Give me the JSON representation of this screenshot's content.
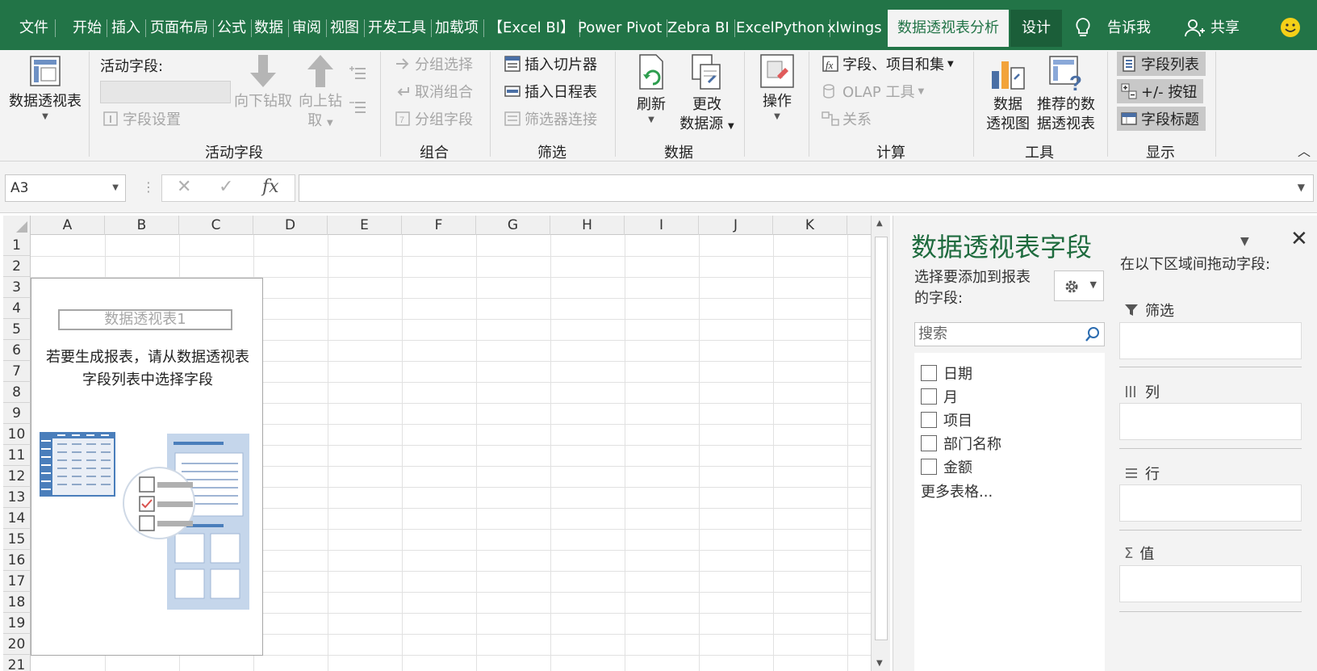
{
  "tabs": {
    "file": "文件",
    "home": "开始",
    "insert": "插入",
    "page_layout": "页面布局",
    "formulas": "公式",
    "data": "数据",
    "review": "审阅",
    "view": "视图",
    "developer": "开发工具",
    "addins": "加载项",
    "excel_bi": "【Excel BI】",
    "power_pivot": "Power Pivot",
    "zebra_bi": "Zebra BI",
    "excel_python": "ExcelPython",
    "xlwings": "xlwings",
    "pivot_analyze": "数据透视表分析",
    "design": "设计",
    "tell_me": "告诉我",
    "share": "共享"
  },
  "ribbon": {
    "pivottable": {
      "label": "数据透视表"
    },
    "active_field": {
      "label": "活动字段:",
      "field_settings": "字段设置",
      "drill_down": "向下钻取",
      "drill_up_1": "向上钻",
      "drill_up_2": "取",
      "group_label": "活动字段"
    },
    "group": {
      "group_selection": "分组选择",
      "ungroup": "取消组合",
      "group_field": "分组字段",
      "group_label": "组合"
    },
    "filter": {
      "insert_slicer": "插入切片器",
      "insert_timeline": "插入日程表",
      "filter_connections": "筛选器连接",
      "group_label": "筛选"
    },
    "data": {
      "refresh": "刷新",
      "change_source_1": "更改",
      "change_source_2": "数据源",
      "group_label": "数据"
    },
    "actions": {
      "label": "操作"
    },
    "calc": {
      "fields_items_sets": "字段、项目和集",
      "olap_tools": "OLAP 工具",
      "relationships": "关系",
      "group_label": "计算"
    },
    "tools": {
      "pivotchart_1": "数据",
      "pivotchart_2": "透视图",
      "recommended_1": "推荐的数",
      "recommended_2": "据透视表",
      "group_label": "工具"
    },
    "show": {
      "field_list": "字段列表",
      "buttons": "+/- 按钮",
      "field_headers": "字段标题",
      "group_label": "显示"
    }
  },
  "formula_bar": {
    "name_box": "A3",
    "cancel": "✕",
    "enter": "✓",
    "fx": "fx"
  },
  "grid": {
    "columns": [
      "A",
      "B",
      "C",
      "D",
      "E",
      "F",
      "G",
      "H",
      "I",
      "J",
      "K"
    ],
    "rows": [
      "1",
      "2",
      "3",
      "4",
      "5",
      "6",
      "7",
      "8",
      "9",
      "10",
      "11",
      "12",
      "13",
      "14",
      "15",
      "16",
      "17",
      "18",
      "19",
      "20",
      "21"
    ]
  },
  "pivot_placeholder": {
    "name": "数据透视表1",
    "hint_1": "若要生成报表，请从数据透视表",
    "hint_2": "字段列表中选择字段"
  },
  "field_pane": {
    "title": "数据透视表字段",
    "choose_label": "选择要添加到报表的字段:",
    "search_placeholder": "搜索",
    "fields": [
      {
        "label": "日期",
        "checked": false
      },
      {
        "label": "月",
        "checked": false
      },
      {
        "label": "项目",
        "checked": false
      },
      {
        "label": "部门名称",
        "checked": false
      },
      {
        "label": "金额",
        "checked": false
      }
    ],
    "more_tables": "更多表格...",
    "drag_title": "在以下区域间拖动字段:",
    "areas": {
      "filters": "筛选",
      "columns": "列",
      "rows": "行",
      "values": "值"
    }
  },
  "colors": {
    "excel_green": "#227447",
    "pane_title_green": "#1e6b3e",
    "ribbon_bg": "#f3f3f3"
  }
}
